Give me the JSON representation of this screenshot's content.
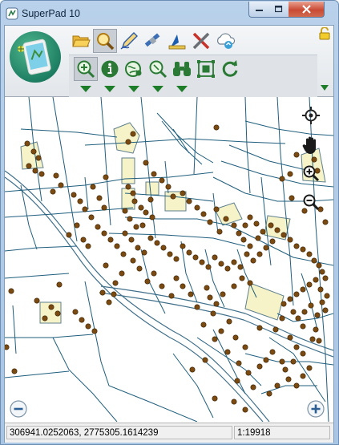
{
  "window": {
    "title": "SuperPad 10"
  },
  "icons": {
    "app": "superpad-app-icon",
    "row1": [
      "open-folder-icon",
      "search-magnifier-icon",
      "edit-pencil-icon",
      "satellite-gps-icon",
      "measure-icon",
      "tools-icon",
      "cloud-sync-icon"
    ],
    "row2": [
      "zoom-in-icon",
      "info-icon",
      "layers-globe-icon",
      "zoom-to-icon",
      "binoculars-icon",
      "select-frame-icon",
      "refresh-icon"
    ]
  },
  "colors": {
    "title_bar": "#b9d1ea",
    "toolbar": "#e8ebee",
    "road": "#1f5e7d",
    "highway": "#3f6f8a",
    "building": "#f6f3c8",
    "point": "#7a4a10",
    "dropdown_arrow": "#1d7d28",
    "close_button": "#c94a34"
  },
  "status": {
    "coordinates": "306941.0252063, 2775305.1614239",
    "scale": "1:19918"
  }
}
